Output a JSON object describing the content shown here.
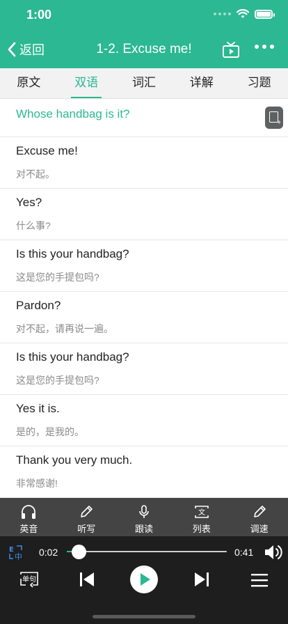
{
  "status": {
    "time": "1:00"
  },
  "nav": {
    "back_label": "返回",
    "title": "1-2. Excuse me!"
  },
  "tabs": [
    {
      "label": "原文",
      "active": false
    },
    {
      "label": "双语",
      "active": true
    },
    {
      "label": "词汇",
      "active": false
    },
    {
      "label": "详解",
      "active": false
    },
    {
      "label": "习题",
      "active": false
    }
  ],
  "lesson": {
    "heading": "Whose handbag is it?",
    "lines": [
      {
        "en": "Excuse me!",
        "cn": "对不起。"
      },
      {
        "en": "Yes?",
        "cn": "什么事?"
      },
      {
        "en": "Is this your handbag?",
        "cn": "这是您的手提包吗?"
      },
      {
        "en": "Pardon?",
        "cn": "对不起，请再说一遍。"
      },
      {
        "en": "Is this your handbag?",
        "cn": "这是您的手提包吗?"
      },
      {
        "en": "Yes it is.",
        "cn": "是的，是我的。"
      },
      {
        "en": "Thank you very much.",
        "cn": "非常感谢!"
      }
    ]
  },
  "toolbar": {
    "items": [
      {
        "label": "英音",
        "icon": "headphones-icon"
      },
      {
        "label": "听写",
        "icon": "pencil-icon"
      },
      {
        "label": "跟读",
        "icon": "microphone-icon"
      },
      {
        "label": "列表",
        "icon": "list-text-icon"
      },
      {
        "label": "调速",
        "icon": "speed-pencil-icon"
      }
    ]
  },
  "player": {
    "current_time": "0:02",
    "total_time": "0:41",
    "progress": 0.05,
    "lang_toggle_label": "E中",
    "mode_label": "单句"
  },
  "colors": {
    "accent": "#2cb892",
    "toolbar_bg": "#444444",
    "player_bg": "#1e1e1e"
  }
}
